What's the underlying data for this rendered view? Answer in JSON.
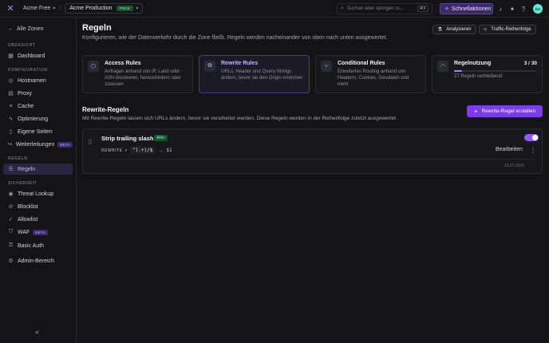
{
  "topbar": {
    "logo_icon": "✕",
    "org": "Acme Free",
    "zone": "Acme Production",
    "zone_badge": "PROD",
    "search_placeholder": "Suchen oder springen zu...",
    "search_shortcut": "⌘K",
    "quick_actions": "Schnellaktionen",
    "avatar": "DA"
  },
  "sidebar": {
    "back": "Alle Zonen",
    "sections": {
      "overview": "ÜBERSICHT",
      "config": "KONFIGURATION",
      "rules": "REGELN",
      "security": "SICHERHEIT"
    },
    "items": {
      "dashboard": "Dashboard",
      "hostnames": "Hostnamen",
      "proxy": "Proxy",
      "cache": "Cache",
      "optimierung": "Optimierung",
      "eigene_seiten": "Eigene Seiten",
      "weiterleitungen": "Weiterleitungen",
      "weiterleitungen_badge": "BETA",
      "regeln": "Regeln",
      "threat_lookup": "Threat Lookup",
      "blocklist": "Blocklist",
      "allowlist": "Allowlist",
      "waf": "WAF",
      "waf_badge": "BETA",
      "basic_auth": "Basic Auth",
      "admin": "Admin-Bereich"
    }
  },
  "header": {
    "title": "Regeln",
    "subtitle": "Konfigurieren, wie der Datenverkehr durch die Zone fließt. Regeln werden nacheinander von oben nach unten ausgewertet.",
    "analyze": "Analysieren",
    "traffic_order": "Traffic-Reihenfolge"
  },
  "cards": {
    "access": {
      "title": "Access Rules",
      "desc": "Anfragen anhand von IP, Land oder ASN blockieren, herausfordern oder zulassen"
    },
    "rewrite": {
      "title": "Rewrite Rules",
      "desc": "URLs, Header und Query-Strings ändern, bevor sie den Origin erreichen"
    },
    "conditional": {
      "title": "Conditional Rules",
      "desc": "Erweitertes Routing anhand von Headern, Cookies, Geodaten und mehr"
    },
    "usage": {
      "title": "Regelnutzung",
      "count": "3 / 30",
      "used": 3,
      "limit": 30,
      "remaining": "27 Regeln verbleibend"
    }
  },
  "rewrite_section": {
    "title": "Rewrite-Regeln",
    "subtitle": "Mit Rewrite-Regeln lassen sich URLs ändern, bevor sie verarbeitet werden. Diese Regeln werden in der Reihenfolge zuletzt ausgewertet.",
    "create": "Rewrite-Regel erstellen"
  },
  "rule": {
    "name": "Strip trailing slash",
    "status": "Aktiv",
    "type": "REWRITE",
    "pattern": "^(.+)/$",
    "arrow": "→",
    "replacement": "$1",
    "edit": "Bearbeiten",
    "date": "23.07.2025"
  },
  "colors": {
    "accent": "#8b5cf6",
    "background": "#141416",
    "success": "#86efac"
  }
}
